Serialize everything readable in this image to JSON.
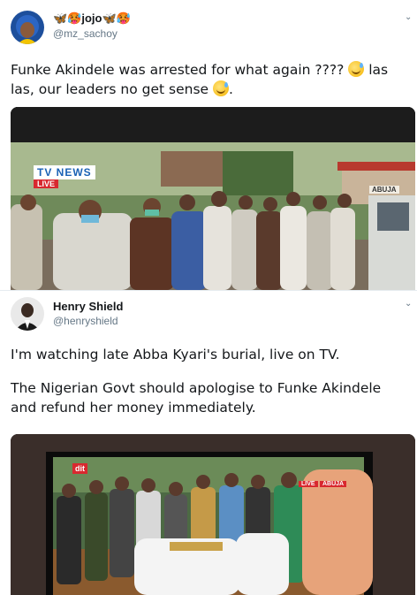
{
  "tweets": [
    {
      "display_name": "🦋🥵jojo🦋🥵",
      "handle": "@mz_sachoy",
      "text_line1": "Funke Akindele was arrested for what again ????",
      "text_line1_tail": "las",
      "text_line2": "las, our leaders no get sense",
      "text_line2_tail": ".",
      "media": {
        "channel_logo": "TV  NEWS",
        "live_tag": "LIVE",
        "sign": "ABUJA"
      }
    },
    {
      "display_name": "Henry Shield",
      "handle": "@henryshield",
      "paragraph1": "I'm watching late Abba Kyari's burial, live on TV.",
      "paragraph2_line1": "The Nigerian Govt should apologise to Funke Akindele",
      "paragraph2_line2": "and refund her money immediately.",
      "media": {
        "channel_logo": "dit",
        "live_tag": "LIVE",
        "location_tag": "ABUJA"
      }
    }
  ],
  "icons": {
    "caret": "chevron-down-icon",
    "emoji": "grinning-sweat-emoji"
  },
  "colors": {
    "handle": "#657786",
    "text": "#14171a",
    "divider": "#e6ecf0",
    "tv_news_blue": "#1a62b5",
    "live_red": "#d8282f"
  }
}
